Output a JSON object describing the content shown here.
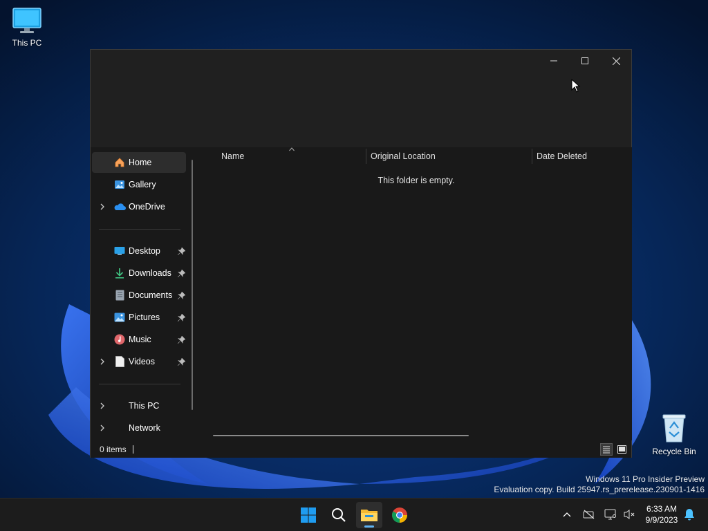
{
  "desktop": {
    "icons": [
      {
        "label": "This PC",
        "icon": "monitor-icon"
      },
      {
        "label": "Recycle Bin",
        "icon": "recycle-bin-icon"
      }
    ],
    "watermark": {
      "line1": "Windows 11 Pro Insider Preview",
      "line2": "Evaluation copy. Build 25947.rs_prerelease.230901-1416"
    }
  },
  "window": {
    "controls": {
      "minimize": "minimize-icon",
      "maximize": "maximize-icon",
      "close": "close-icon"
    },
    "nav": {
      "items": [
        {
          "label": "Home",
          "icon": "home-icon",
          "selected": true,
          "expandable": false,
          "pinned": false
        },
        {
          "label": "Gallery",
          "icon": "gallery-icon",
          "selected": false,
          "expandable": false,
          "pinned": false
        },
        {
          "label": "OneDrive",
          "icon": "onedrive-icon",
          "selected": false,
          "expandable": true,
          "pinned": false
        },
        {
          "label": "Desktop",
          "icon": "desktop-folder-icon",
          "selected": false,
          "expandable": false,
          "pinned": true
        },
        {
          "label": "Downloads",
          "icon": "downloads-icon",
          "selected": false,
          "expandable": false,
          "pinned": true
        },
        {
          "label": "Documents",
          "icon": "documents-icon",
          "selected": false,
          "expandable": false,
          "pinned": true
        },
        {
          "label": "Pictures",
          "icon": "pictures-icon",
          "selected": false,
          "expandable": false,
          "pinned": true
        },
        {
          "label": "Music",
          "icon": "music-icon",
          "selected": false,
          "expandable": false,
          "pinned": true
        },
        {
          "label": "Videos",
          "icon": "videos-icon",
          "selected": false,
          "expandable": true,
          "pinned": true
        },
        {
          "label": "This PC",
          "icon": "",
          "selected": false,
          "expandable": true,
          "pinned": false
        },
        {
          "label": "Network",
          "icon": "",
          "selected": false,
          "expandable": true,
          "pinned": false
        }
      ]
    },
    "columns": [
      "Name",
      "Original Location",
      "Date Deleted"
    ],
    "empty_message": "This folder is empty.",
    "status": {
      "items_count": "0 items"
    }
  },
  "taskbar": {
    "apps": [
      {
        "name": "Start",
        "icon": "windows-start-icon"
      },
      {
        "name": "Search",
        "icon": "search-icon"
      },
      {
        "name": "File Explorer",
        "icon": "file-explorer-icon",
        "active": true
      },
      {
        "name": "Google Chrome",
        "icon": "chrome-icon"
      }
    ],
    "tray": [
      "chevron-up-icon",
      "network-disconnected-icon",
      "display-icon",
      "volume-muted-icon"
    ],
    "clock": {
      "time": "6:33 AM",
      "date": "9/9/2023"
    },
    "notification": "notification-bell-icon"
  },
  "colors": {
    "accent": "#4cc2ff",
    "window_bg": "#191919",
    "titlebar_bg": "#202020",
    "taskbar_bg": "#1c1c1c"
  }
}
